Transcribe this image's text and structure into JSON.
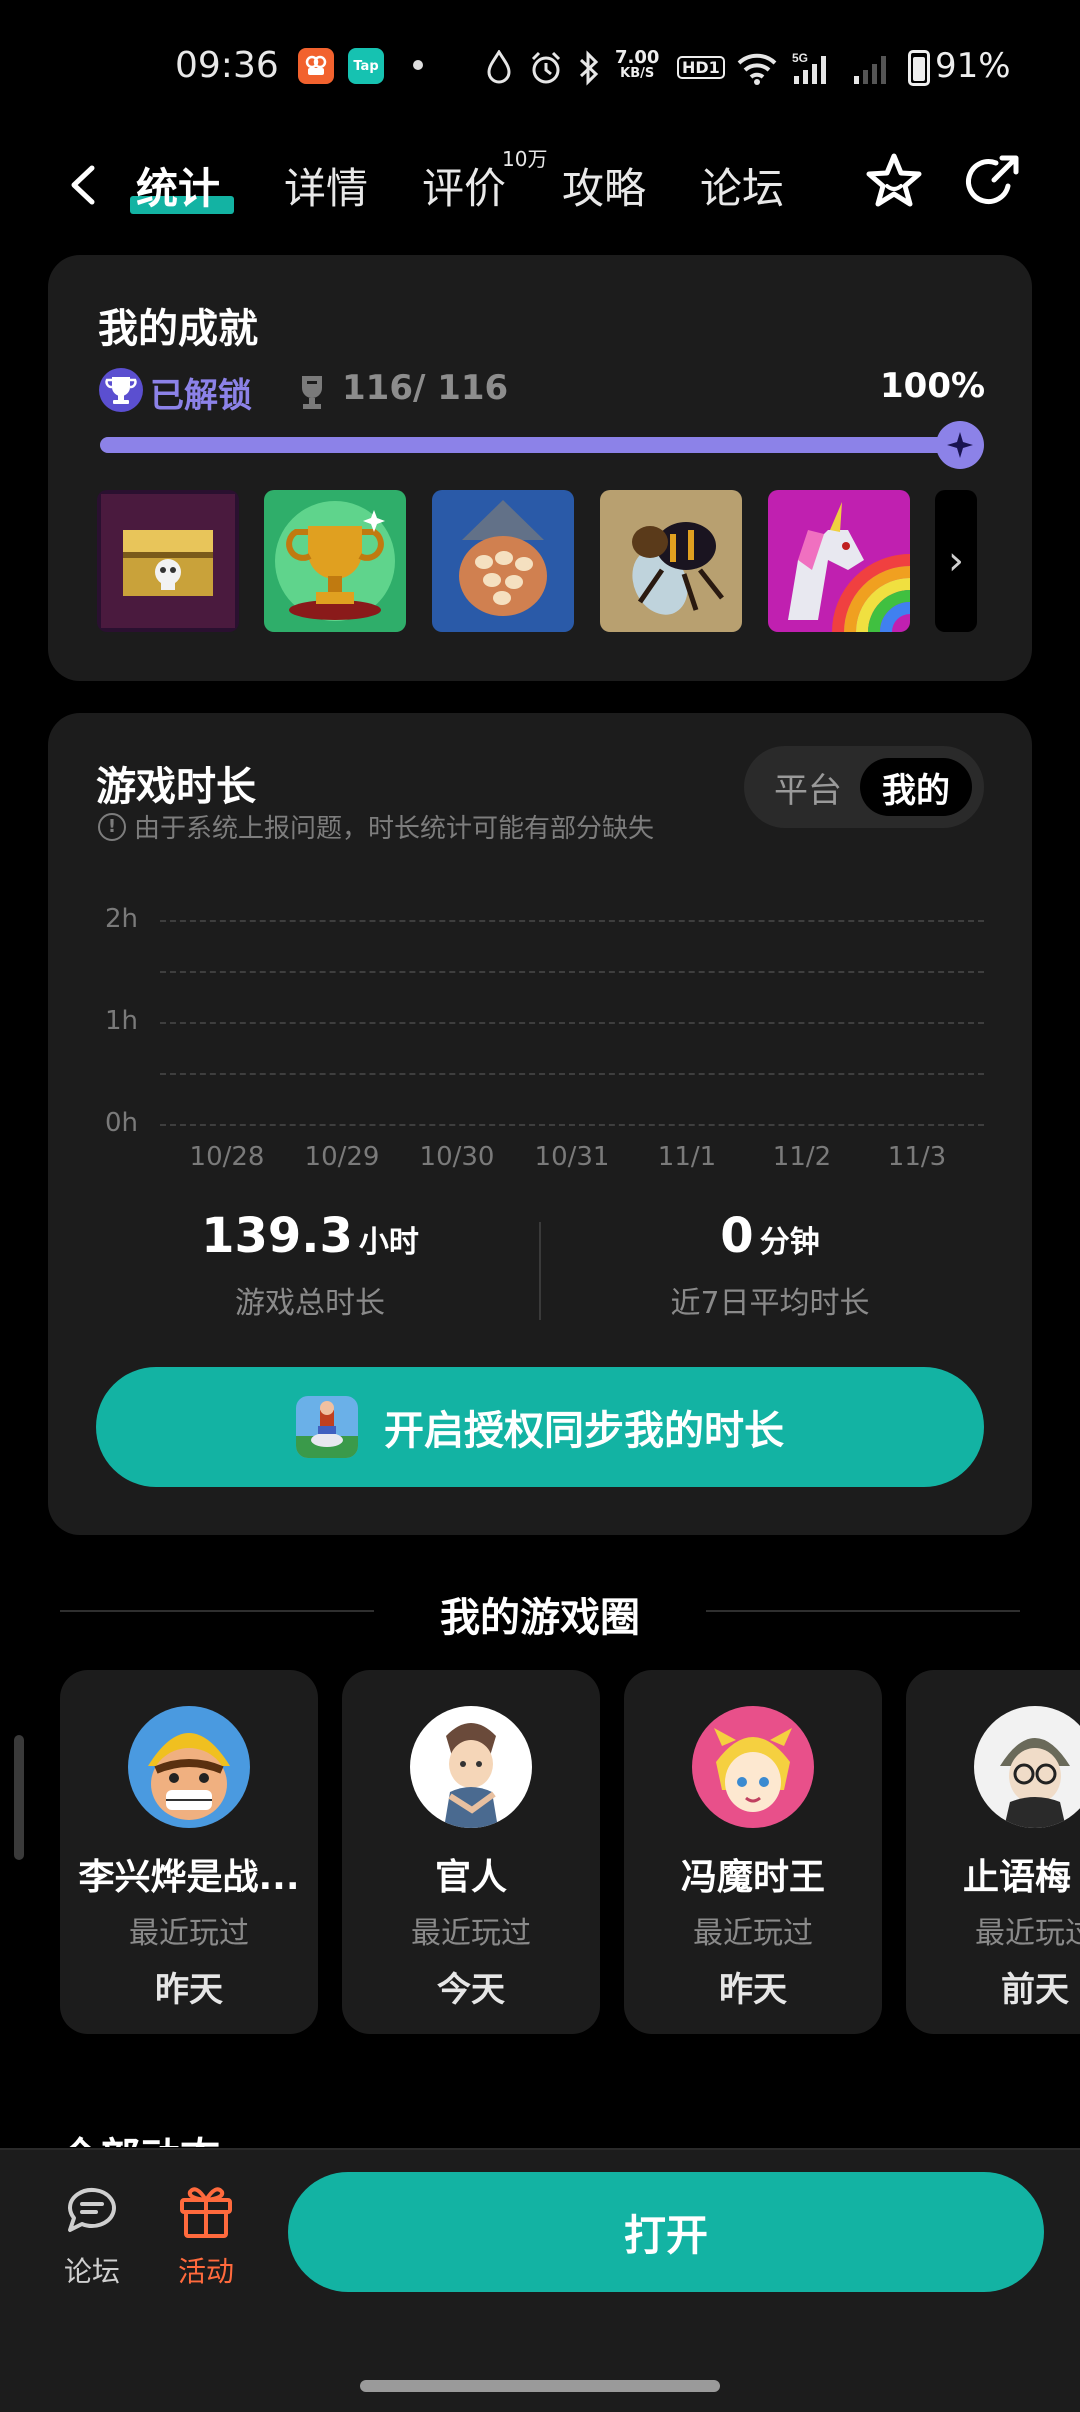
{
  "status_bar": {
    "time": "09:36",
    "app_badge_2": "Tap",
    "network_speed_value": "7.00",
    "network_speed_unit": "KB/S",
    "hd_label": "HD1",
    "signal_label": "5G",
    "battery": "91%"
  },
  "nav": {
    "tabs": [
      "统计",
      "详情",
      "评价",
      "攻略",
      "论坛"
    ],
    "active_tab": "统计",
    "review_badge": "10万"
  },
  "achievements": {
    "title": "我的成就",
    "unlocked_label": "已解锁",
    "count": "116/ 116",
    "percent": "100%",
    "progress": 1.0,
    "accent_color": "#8c82e8",
    "tiles": [
      "treasure-chest",
      "golden-trophy",
      "egg-nest",
      "bee",
      "rainbow-unicorn"
    ]
  },
  "playtime": {
    "title": "游戏时长",
    "notice": "由于系统上报问题，时长统计可能有部分缺失",
    "segments": [
      "平台",
      "我的"
    ],
    "selected_segment": "我的",
    "y_ticks": [
      "2h",
      "1h",
      "0h"
    ],
    "x_ticks": [
      "10/28",
      "10/29",
      "10/30",
      "10/31",
      "11/1",
      "11/2",
      "11/3"
    ],
    "total_value": "139.3",
    "total_unit": "小时",
    "total_label": "游戏总时长",
    "avg_value": "0",
    "avg_unit": "分钟",
    "avg_label": "近7日平均时长",
    "sync_button": "开启授权同步我的时长",
    "accent_color": "#13b3a3"
  },
  "game_circle": {
    "title": "我的游戏圈",
    "friends": [
      {
        "name": "李兴烨是战...",
        "sub": "最近玩过",
        "when": "昨天"
      },
      {
        "name": "官人",
        "sub": "最近玩过",
        "when": "今天"
      },
      {
        "name": "冯魔时王",
        "sub": "最近玩过",
        "when": "昨天"
      },
      {
        "name": "止语梅「",
        "sub": "最近玩过",
        "when": "前天"
      }
    ]
  },
  "feed": {
    "peek_title": "全部动态"
  },
  "bottom_bar": {
    "forum_label": "论坛",
    "activity_label": "活动",
    "open_button": "打开",
    "activity_color": "#ff6a3d"
  }
}
